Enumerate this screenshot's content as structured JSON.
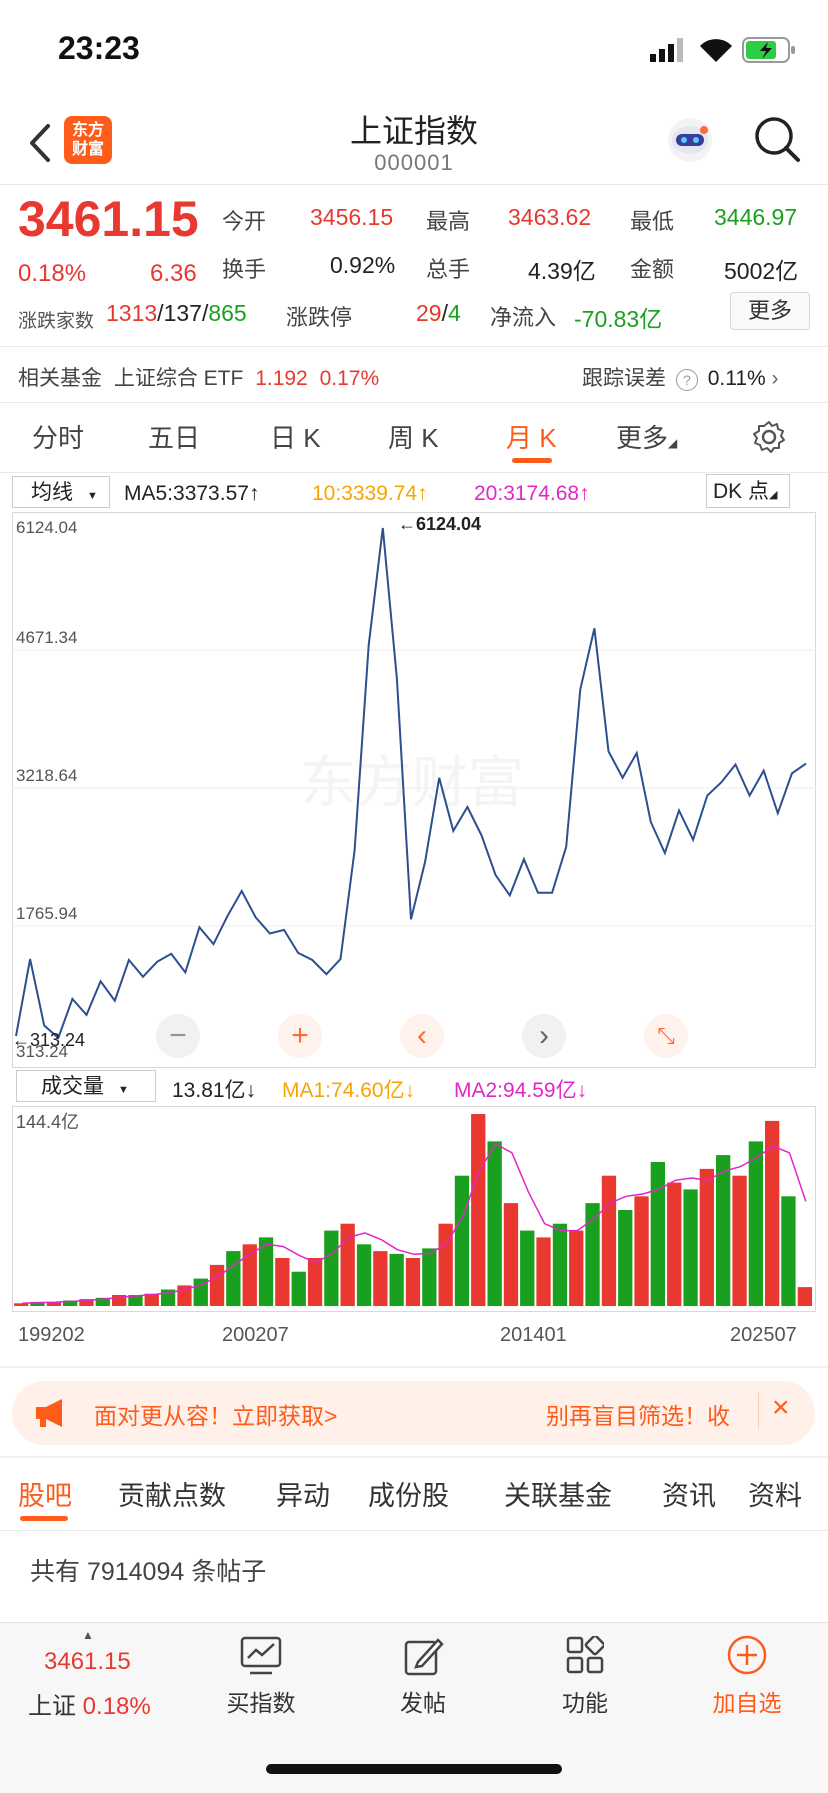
{
  "status_bar": {
    "time": "23:23"
  },
  "header": {
    "title": "上证指数",
    "code": "000001",
    "logo_text_1": "东方",
    "logo_text_2": "财富"
  },
  "quote": {
    "price": "3461.15",
    "change_pct": "0.18%",
    "change": "6.36",
    "open_label": "今开",
    "open": "3456.15",
    "high_label": "最高",
    "high": "3463.62",
    "low_label": "最低",
    "low": "3446.97",
    "turnover_label": "换手",
    "turnover": "0.92%",
    "volume_label": "总手",
    "volume": "4.39亿",
    "amount_label": "金额",
    "amount": "5002亿",
    "breadth_label": "涨跌家数",
    "breadth_up": "1313",
    "breadth_flat": "137",
    "breadth_down": "865",
    "limit_label": "涨跌停",
    "limit_up": "29",
    "limit_down": "4",
    "netflow_label": "净流入",
    "netflow": "-70.83亿",
    "more_button": "更多"
  },
  "fund_row": {
    "label": "相关基金",
    "fund_name": "上证综合 ETF",
    "fund_price": "1.192",
    "fund_change": "0.17%",
    "tracking_label": "跟踪误差",
    "tracking_value": "0.11%"
  },
  "period_tabs": [
    {
      "label": "分时"
    },
    {
      "label": "五日"
    },
    {
      "label": "日 K"
    },
    {
      "label": "周 K"
    },
    {
      "label": "月 K",
      "active": true
    },
    {
      "label": "更多"
    }
  ],
  "kline": {
    "indicator_select": "均线",
    "ma5": "MA5:3373.57",
    "ma10": "10:3339.74",
    "ma20": "20:3174.68",
    "dk_button": "DK 点",
    "watermark": "东方财富",
    "y_labels": [
      "6124.04",
      "4671.34",
      "3218.64",
      "1765.94",
      "313.24"
    ],
    "max_marker": "6124.04",
    "min_marker": "313.24",
    "colors": {
      "line": "#2c4f8f",
      "ma5": "#ff9f00",
      "ma10": "#ff9f00",
      "ma20": "#e028c8"
    }
  },
  "volume_panel": {
    "indicator_select": "成交量",
    "value": "13.81亿",
    "ma1": "MA1:74.60亿",
    "ma2": "MA2:94.59亿",
    "max_label": "144.4亿",
    "x_labels": [
      "199202",
      "200207",
      "201401",
      "202507"
    ]
  },
  "chart_data": {
    "type": "line",
    "title": "",
    "x_ticks": [
      "199202",
      "200207",
      "201401",
      "202507"
    ],
    "ylim": [
      313.24,
      6124.04
    ],
    "series": [
      {
        "values": [
          380,
          1250,
          500,
          360,
          800,
          620,
          1000,
          780,
          1240,
          1050,
          1220,
          1310,
          1100,
          1610,
          1420,
          1740,
          2020,
          1720,
          1540,
          1580,
          1320,
          1240,
          1080,
          1250,
          2480,
          4800,
          6124,
          4420,
          1700,
          2350,
          3300,
          2700,
          2970,
          2650,
          2200,
          1970,
          2380,
          2000,
          2000,
          2520,
          4300,
          4990,
          3600,
          3300,
          3580,
          2800,
          2450,
          2930,
          2600,
          3100,
          3250,
          3450,
          3100,
          3380,
          2900,
          3350,
          3461
        ]
      },
      {
        "name": "成交量",
        "values": [
          2,
          3,
          3,
          4,
          5,
          6,
          8,
          8,
          9,
          12,
          15,
          20,
          30,
          40,
          45,
          50,
          35,
          25,
          35,
          55,
          60,
          45,
          40,
          38,
          35,
          42,
          60,
          95,
          140,
          120,
          75,
          55,
          50,
          60,
          55,
          75,
          95,
          70,
          80,
          105,
          90,
          85,
          100,
          110,
          95,
          120,
          135,
          80,
          13.81
        ]
      }
    ]
  },
  "banner": {
    "text_left": "面对更从容！立即获取>",
    "text_right": "别再盲目筛选！收"
  },
  "bottom_tabs": [
    {
      "label": "股吧",
      "active": true
    },
    {
      "label": "贡献点数"
    },
    {
      "label": "异动"
    },
    {
      "label": "成份股"
    },
    {
      "label": "关联基金"
    },
    {
      "label": "资讯"
    },
    {
      "label": "资料"
    }
  ],
  "posts": {
    "count_text": "共有 7914094 条帖子"
  },
  "bottom_nav": {
    "quote_price": "3461.15",
    "quote_name": "上证",
    "quote_pct": "0.18%",
    "buy": "买指数",
    "post": "发帖",
    "func": "功能",
    "add": "加自选"
  }
}
